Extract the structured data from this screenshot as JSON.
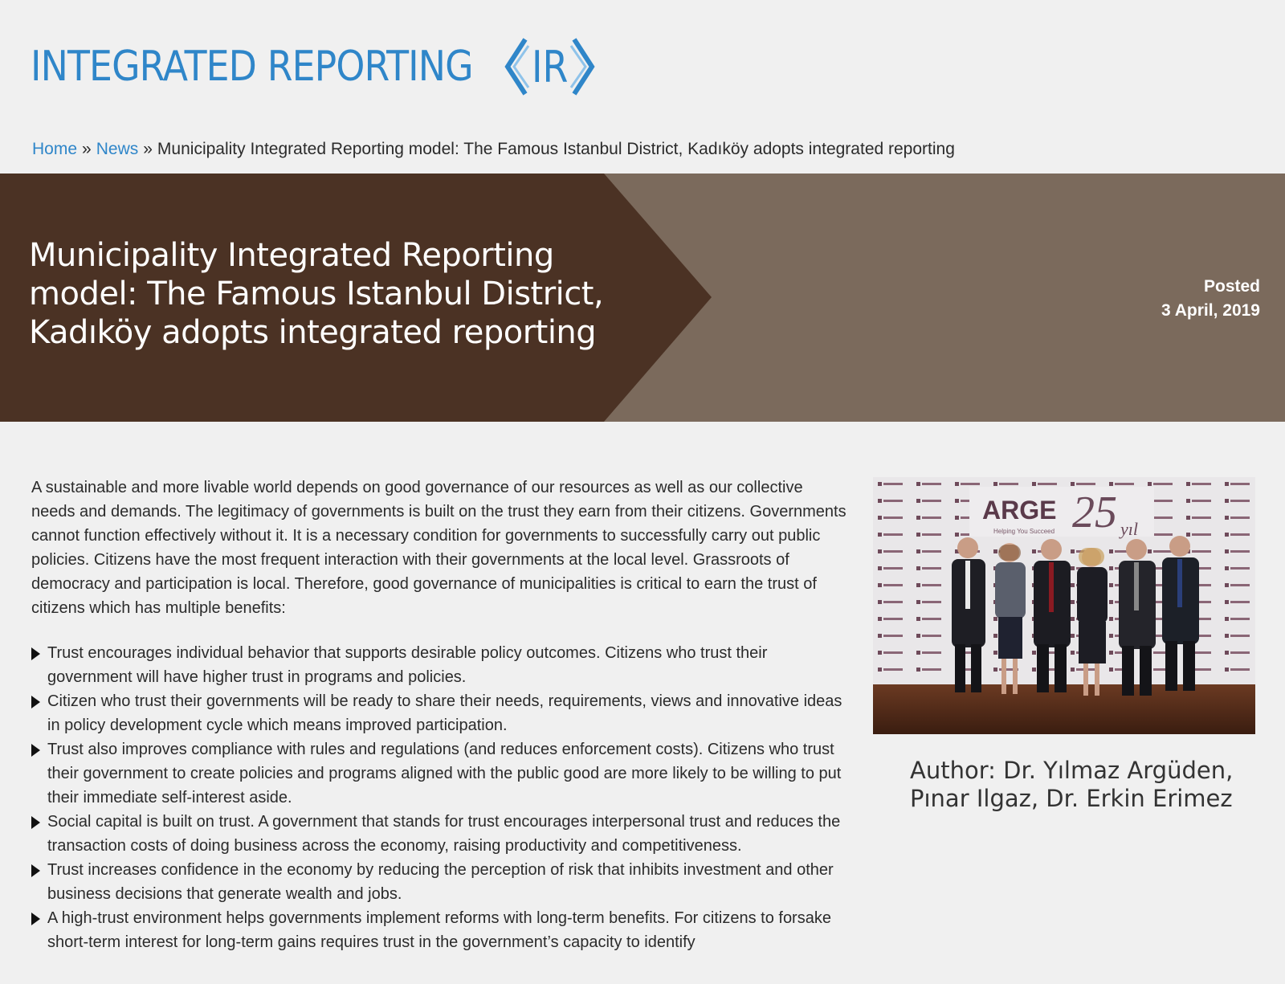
{
  "header": {
    "logo_text": "INTEGRATED REPORTING",
    "logo_mark_text": "IR",
    "accent_color": "#2f86c9"
  },
  "breadcrumb": {
    "home": "Home",
    "separator": "»",
    "news": "News",
    "current": "Municipality Integrated Reporting model: The Famous Istanbul District, Kadıköy adopts integrated reporting"
  },
  "hero": {
    "title": "Municipality Integrated Reporting model: The Famous Istanbul District, Kadıköy adopts integrated reporting",
    "posted_label": "Posted",
    "posted_date": "3 April, 2019",
    "dark_color": "#4b3224",
    "light_color": "#7b6a5c"
  },
  "article": {
    "intro": "A sustainable and more livable world depends on good governance of our resources as well as our collective needs and demands.  The legitimacy of governments is built on the trust they earn from their citizens. Governments cannot function effectively without it.  It is a necessary condition for governments to successfully carry out public policies. Citizens have the most frequent interaction with their governments at the local level.  Grassroots of democracy and participation is local.  Therefore, good governance of municipalities is critical to earn the trust of citizens which has multiple benefits:",
    "bullets": [
      "Trust encourages individual behavior that supports desirable policy outcomes. Citizens who trust their government will have higher trust in programs and policies.",
      "Citizen who trust their governments will be ready to share their needs, requirements, views and innovative ideas in policy development cycle which means improved participation.",
      "Trust also improves compliance with rules and regulations (and reduces enforcement costs). Citizens who trust their government to create policies and programs aligned with the public good are more likely to be willing to put their immediate self-interest aside.",
      "Social capital is built on trust. A government that stands for trust encourages interpersonal trust and reduces the transaction costs of doing business across the economy, raising productivity and competitiveness.",
      "Trust increases confidence in the economy by reducing the perception of risk that inhibits investment and other business decisions that generate wealth and jobs.",
      "A high-trust environment helps governments implement reforms with long-term benefits. For citizens to forsake short-term interest for long-term gains requires trust in the government’s capacity to identify"
    ]
  },
  "sidebar": {
    "photo": {
      "brand": "ARGE",
      "anniversary_number": "25",
      "anniversary_suffix": "yıl",
      "tagline": "Helping You Succeed"
    },
    "author": "Author: Dr. Yılmaz Argüden, Pınar Ilgaz, Dr. Erkin Erimez"
  }
}
